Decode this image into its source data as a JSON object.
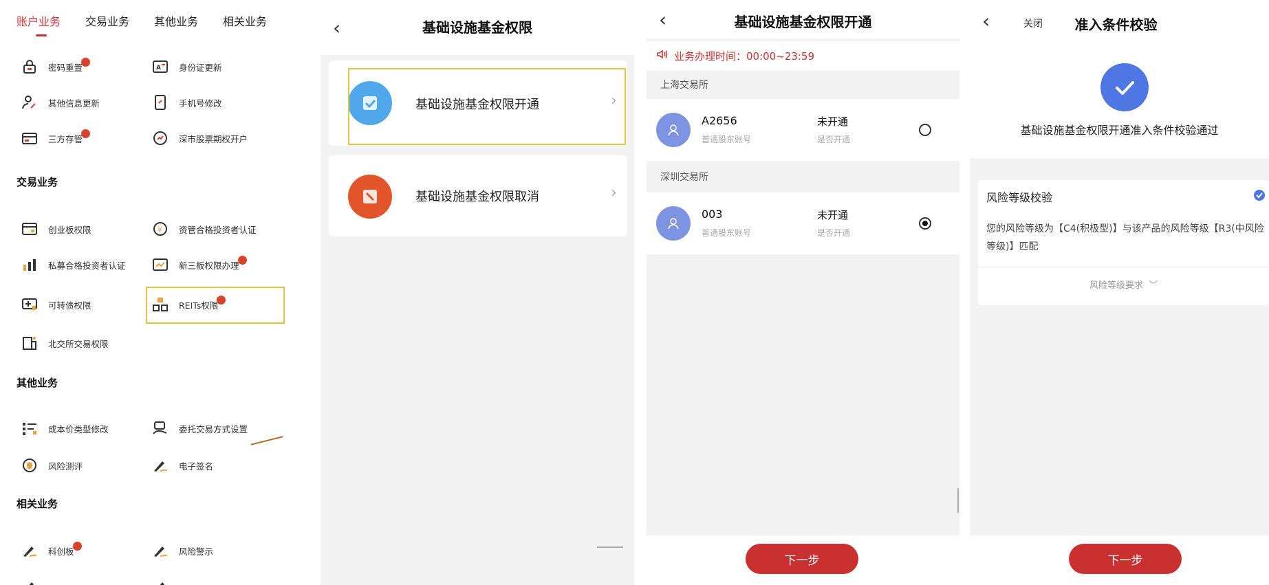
{
  "panel1": {
    "tabs": [
      "账户业务",
      "交易业务",
      "其他业务",
      "相关业务"
    ],
    "account_items": [
      {
        "label": "密码重置",
        "icon": "lock-icon",
        "badge": true
      },
      {
        "label": "身份证更新",
        "icon": "id-card-icon",
        "badge": false
      },
      {
        "label": "其他信息更新",
        "icon": "user-edit-icon",
        "badge": false
      },
      {
        "label": "手机号修改",
        "icon": "phone-edit-icon",
        "badge": false
      },
      {
        "label": "三方存管",
        "icon": "bank-card-icon",
        "badge": true
      },
      {
        "label": "深市股票期权开户",
        "icon": "options-icon",
        "badge": false
      }
    ],
    "trade_title": "交易业务",
    "trade_items": [
      {
        "label": "创业板权限",
        "icon": "board-icon",
        "badge": false
      },
      {
        "label": "资管合格投资者认证",
        "icon": "yuan-cert-icon",
        "badge": false
      },
      {
        "label": "私募合格投资者认证",
        "icon": "bar-chart-icon",
        "badge": false
      },
      {
        "label": "新三板权限办理",
        "icon": "neeq-icon",
        "badge": true
      },
      {
        "label": "可转债权限",
        "icon": "bond-icon",
        "badge": false
      },
      {
        "label": "REITs权限",
        "icon": "reits-icon",
        "badge": true
      },
      {
        "label": "北交所交易权限",
        "icon": "building-icon",
        "badge": false
      }
    ],
    "other_title": "其他业务",
    "other_items": [
      {
        "label": "成本价类型修改",
        "icon": "list-edit-icon",
        "badge": false
      },
      {
        "label": "委托交易方式设置",
        "icon": "hand-order-icon",
        "badge": false
      },
      {
        "label": "风险测评",
        "icon": "shield-icon",
        "badge": false
      },
      {
        "label": "电子签名",
        "icon": "pen-sign-icon",
        "badge": false
      }
    ],
    "related_title": "相关业务",
    "related_items": [
      {
        "label": "科创板",
        "icon": "pen-sign-icon",
        "badge": true
      },
      {
        "label": "风险警示",
        "icon": "pen-sign-icon",
        "badge": false
      }
    ]
  },
  "panel2": {
    "title": "基础设施基金权限",
    "options": [
      {
        "label": "基础设施基金权限开通",
        "icon": "open-permission-icon",
        "color": "#4ea8ea"
      },
      {
        "label": "基础设施基金权限取消",
        "icon": "cancel-permission-icon",
        "color": "#e2552b"
      }
    ]
  },
  "panel3": {
    "title": "基础设施基金权限开通",
    "notice": "业务办理时间：00:00~23:59",
    "exchanges": [
      {
        "name": "上海交易所",
        "account": "A2656",
        "account_type": "普通股东账号",
        "status": "未开通",
        "status_sub": "是否开通",
        "selected": false
      },
      {
        "name": "深圳交易所",
        "account": "003",
        "account_type": "普通股东账号",
        "status": "未开通",
        "status_sub": "是否开通",
        "selected": true
      }
    ],
    "next_button": "下一步"
  },
  "panel4": {
    "close_label": "关闭",
    "title": "准入条件校验",
    "result_text": "基础设施基金权限开通准入条件校验通过",
    "check_title": "风险等级校验",
    "check_desc": "您的风险等级为【C4(积极型)】与该产品的风险等级【R3(中风险等级)】匹配",
    "requirement_link": "风险等级要求",
    "next_button": "下一步"
  },
  "colors": {
    "accent_red": "#c8312f",
    "accent_blue": "#4e77e4",
    "highlight_yellow": "#e8c33f"
  }
}
